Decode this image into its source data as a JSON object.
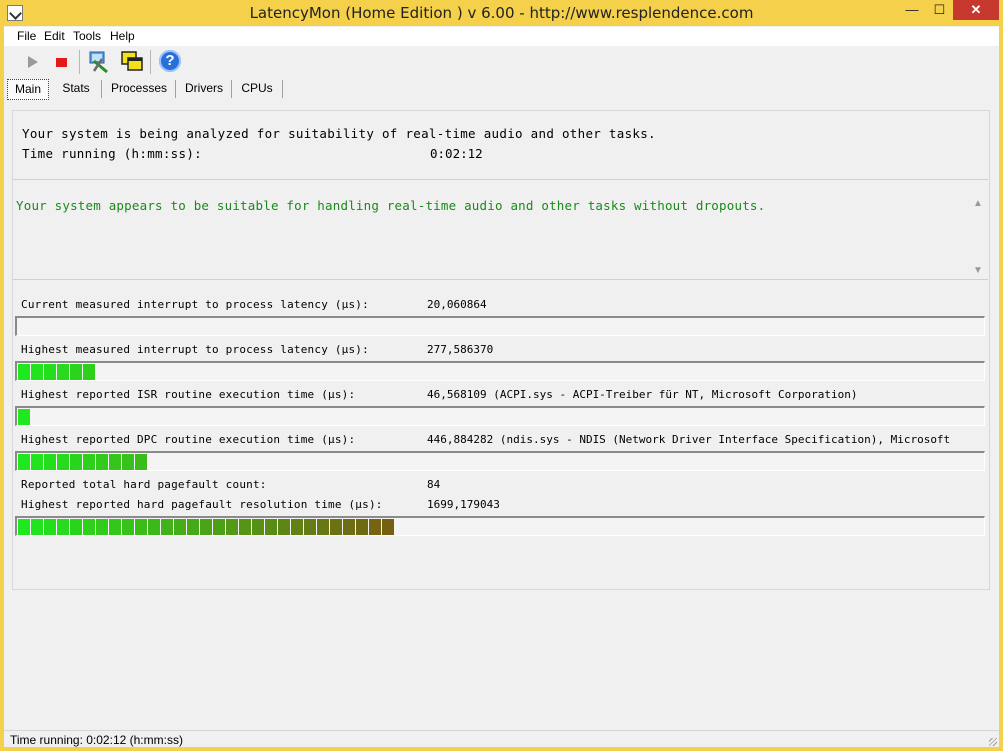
{
  "window": {
    "title": "LatencyMon  (Home Edition )  v 6.00 - http://www.resplendence.com",
    "minimize_glyph": "—",
    "maximize_glyph": "☐",
    "close_glyph": "✕"
  },
  "menu": [
    "File",
    "Edit",
    "Tools",
    "Help"
  ],
  "toolbar": {
    "icons": [
      "play-icon",
      "stop-icon",
      "tools-icon",
      "windows-icon",
      "help-icon"
    ]
  },
  "tabs": [
    "Main",
    "Stats",
    "Processes",
    "Drivers",
    "CPUs"
  ],
  "intro": {
    "line1": "Your system is being analyzed for suitability of real-time audio and other tasks.",
    "time_label": "Time running (h:mm:ss):",
    "time_value": "0:02:12"
  },
  "verdict": {
    "text": "Your system appears to be suitable for handling real-time audio and other tasks without dropouts.",
    "color": "#1a8a1a"
  },
  "metrics": [
    {
      "label": "Current measured interrupt to process latency (µs):",
      "value": "20,060864",
      "level": 0
    },
    {
      "label": "Highest measured interrupt to process latency (µs):",
      "value": "277,586370",
      "level": 6
    },
    {
      "label": "Highest reported ISR routine execution time (µs):",
      "value": "46,568109   (ACPI.sys - ACPI-Treiber für NT, Microsoft Corporation)",
      "level": 1
    },
    {
      "label": "Highest reported DPC routine execution time (µs):",
      "value": "446,884282   (ndis.sys - NDIS (Network Driver Interface Specification), Microsoft",
      "level": 10
    },
    {
      "label": "Reported total hard pagefault count:",
      "value": "84"
    },
    {
      "label": "Highest reported hard pagefault resolution time (µs):",
      "value": "1699,179043",
      "level": 29
    }
  ],
  "status": {
    "text": "Time running: 0:02:12  (h:mm:ss)"
  },
  "colors": {
    "title_bar": "#f5d04b",
    "bar_start": "#1ee81e",
    "bar_end": "#7a5a12"
  }
}
